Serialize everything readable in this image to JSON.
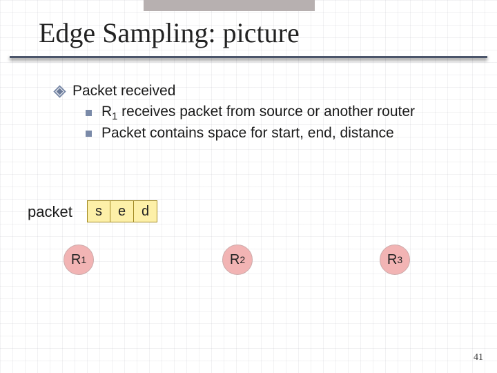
{
  "title": "Edge Sampling: picture",
  "bullets": {
    "main": "Packet received",
    "sub1_pre": "R",
    "sub1_num": "1",
    "sub1_post": " receives packet from source or another router",
    "sub2": "Packet contains space for start, end, distance"
  },
  "packet": {
    "label": "packet",
    "cells": {
      "c0": "s",
      "c1": "e",
      "c2": "d"
    }
  },
  "routers": {
    "r_label": "R",
    "n1": "1",
    "n2": "2",
    "n3": "3"
  },
  "page_number": "41"
}
